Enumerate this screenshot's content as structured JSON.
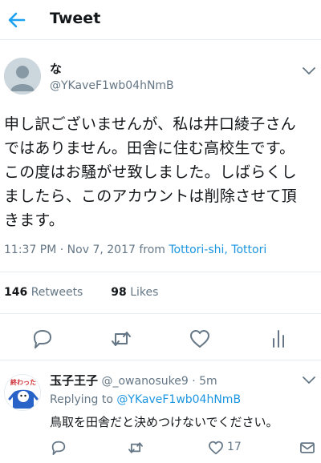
{
  "header": {
    "title": "Tweet",
    "back_icon": "back-arrow-icon",
    "accent": "#1da1f2"
  },
  "tweet": {
    "display_name": "な",
    "handle": "@YKaveF1wb04hNmB",
    "text_lines": [
      "申し訳ございませんが、私は井口綾子さん",
      "ではありません。田舎に住む高校生です。",
      "この度はお騒がせ致しました。しばらくし",
      "ましたら、このアカウントは削除させて頂",
      "きます。"
    ],
    "time": "11:37 PM · Nov 7, 2017 from ",
    "location": "Tottori-shi, Tottori",
    "retweets_count": "146",
    "retweets_label": "Retweets",
    "likes_count": "98",
    "likes_label": "Likes",
    "actions": [
      "reply-icon",
      "retweet-icon",
      "like-icon",
      "analytics-icon"
    ]
  },
  "reply": {
    "display_name": "玉子王子",
    "handle_time": "@_owanosuke9 · 5m",
    "replying_prefix": "Replying to ",
    "replying_to": "@YKaveF1wb04hNmB",
    "text": "鳥取を田舎だと決めつけないでください。",
    "like_count": "17",
    "avatar_text": "終わった"
  },
  "colors": {
    "link": "#1b95e0",
    "muted": "#657786",
    "text": "#14171a",
    "border": "#e6ecf0"
  }
}
